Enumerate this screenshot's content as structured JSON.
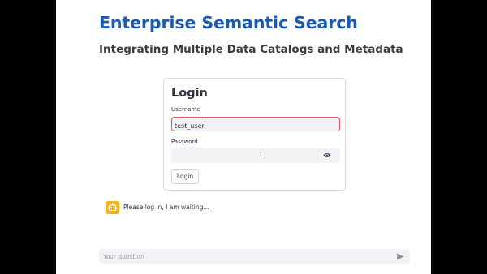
{
  "header": {
    "title": "Enterprise Semantic Search",
    "subtitle": "Integrating Multiple Data Catalogs and Metadata"
  },
  "login": {
    "title": "Login",
    "username_label": "Username",
    "username_value": "test_user",
    "password_label": "Password",
    "password_value": "",
    "toggle_icon": "eye-icon",
    "submit_label": "Login"
  },
  "chat": {
    "avatar_icon": "robot-icon",
    "avatar_color": "#f5b324",
    "message": "Please log in, I am waiting...",
    "input_placeholder": "Your question",
    "send_icon": "send-icon"
  },
  "colors": {
    "title": "#1c5ab0",
    "input_error_border": "#e0555d",
    "input_background": "#f0f2f6"
  }
}
